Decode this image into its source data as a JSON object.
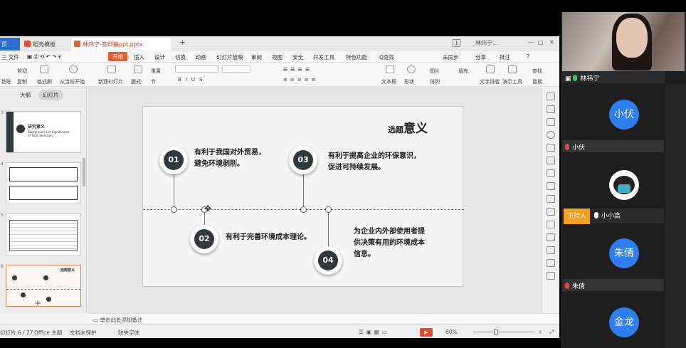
{
  "titlebar": {
    "tabs": [
      {
        "label": "页"
      },
      {
        "label": "稻壳模板"
      },
      {
        "label": "林炜宁-答辩稿ppt.pptx"
      }
    ],
    "page_count": "1",
    "user_name": "_林炜宁..."
  },
  "menubar": {
    "file": "三 文件",
    "items": [
      "开始",
      "插入",
      "设计",
      "切换",
      "动画",
      "幻灯片放映",
      "审阅",
      "视图",
      "安全",
      "开发工具",
      "特色功能"
    ],
    "search": "Q查找",
    "right": [
      "未同步",
      "分享",
      "批注"
    ]
  },
  "ribbon": {
    "cut": "剪切",
    "copy": "复制",
    "format_painter": "格式刷",
    "paste": "粘贴",
    "from_current": "从当前开始",
    "new_slide": "新建幻灯片",
    "layout": "版式",
    "section": "节",
    "reset": "重置",
    "textbox": "文本框",
    "shape": "形状",
    "picture": "图片",
    "arrange": "排列",
    "fill": "填充",
    "text_tools": "文字排版",
    "smart": "演示工具",
    "find": "查找",
    "replace": "替换"
  },
  "leftpane": {
    "outline": "大纲",
    "slides": "幻灯片",
    "thumb_numbers": [
      "3",
      "4",
      "5",
      "6"
    ],
    "thumb1_title": "研究意义",
    "thumb1_sub": "Background and Significance of Topic Selection",
    "thumb4_title": "选题意义"
  },
  "slide": {
    "title_small": "选题",
    "title_big": "意义",
    "points": [
      {
        "num": "01",
        "text_l1": "有利于我国对外贸易，",
        "text_l2": "避免环境剥削。"
      },
      {
        "num": "02",
        "text_l1": "有利于完善环境成本理论。",
        "text_l2": ""
      },
      {
        "num": "03",
        "text_l1": "有利于提高企业的环保意识，",
        "text_l2": "促进可持续发展。"
      },
      {
        "num": "04",
        "text_l1": "为企业内外部使用者提",
        "text_l2": "供决策有用的环境成本",
        "text_l3": "信息。"
      }
    ]
  },
  "notes": {
    "placeholder": "单击此处添加备注"
  },
  "statusbar": {
    "slide_count": "幻灯片 6 / 27",
    "theme": "Office 主题",
    "backup": "文档未保护",
    "font_missing": "缺失字体",
    "zoom": "80%"
  },
  "meeting": {
    "presenter": "林祎宁",
    "participants": [
      {
        "avatar": "小伏",
        "name": "小伏"
      },
      {
        "name": "小小高",
        "badge": "主持人"
      },
      {
        "avatar": "朱倩",
        "name": "朱倩"
      },
      {
        "avatar": "金龙",
        "name": "金龙"
      }
    ]
  }
}
